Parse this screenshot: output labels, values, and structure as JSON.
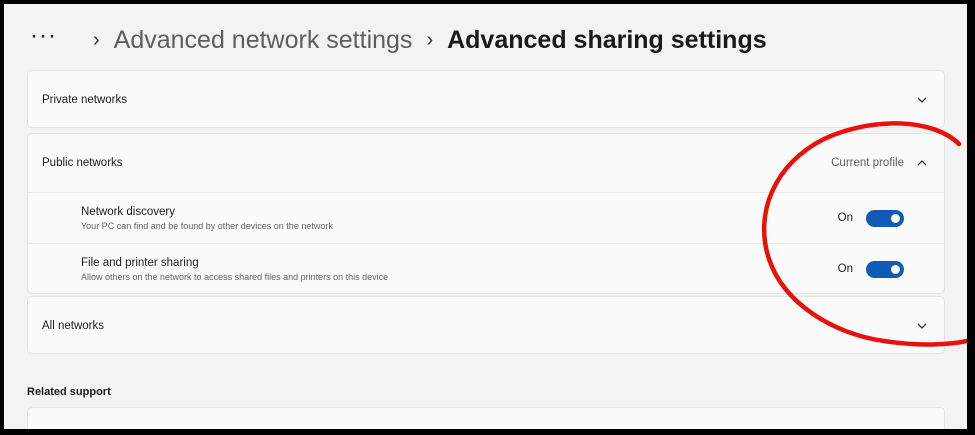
{
  "breadcrumb": {
    "more": "···",
    "parent": "Advanced network settings",
    "current": "Advanced sharing settings",
    "separator": "›"
  },
  "sections": {
    "private": {
      "title": "Private networks"
    },
    "public": {
      "title": "Public networks",
      "badge": "Current profile",
      "settings": [
        {
          "title": "Network discovery",
          "description": "Your PC can find and be found by other devices on the network",
          "state_label": "On",
          "enabled": true
        },
        {
          "title": "File and printer sharing",
          "description": "Allow others on the network to access shared files and printers on this device",
          "state_label": "On",
          "enabled": true
        }
      ]
    },
    "all": {
      "title": "All networks"
    }
  },
  "related_support": {
    "title": "Related support"
  },
  "colors": {
    "accent": "#0f5cb8",
    "annotation": "#e8120c",
    "background": "#f3f3f3",
    "card": "#fbfbfb"
  },
  "icons": {
    "chevron_down": "chevron-down-icon",
    "chevron_up": "chevron-up-icon"
  }
}
